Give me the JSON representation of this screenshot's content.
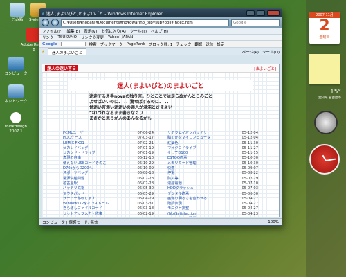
{
  "desktop": {
    "icons": [
      {
        "label": "ごみ箱"
      },
      {
        "label": "S-ViewNX"
      },
      {
        "label": "Adobe Reader 8"
      },
      {
        "label": "コンピュータ"
      },
      {
        "label": "ネットワーク"
      },
      {
        "label": "thinkdesign 2007.1"
      }
    ]
  },
  "window": {
    "title": "迷人(まよいびと)のまよいごと - Windows Internet Explorer",
    "address": "C:¥Users¥nobata¥Documents¥hp¥owarino_top¥sub¥ooli¥index.htm",
    "search_placeholder": "Google",
    "menu": [
      "ファイル(F)",
      "編集(E)",
      "表示(V)",
      "お気に入り(A)",
      "ツール(T)",
      "ヘルプ(H)"
    ],
    "links": [
      "リンク",
      "TSUKUMO",
      "リンクの変更",
      "Yahoo! JAPAN"
    ],
    "google_bar": [
      "Google",
      "検索",
      "ブックマーク",
      "PageRank",
      "ブロック数: 1",
      "チェック",
      "翻訳",
      "送信",
      "設定"
    ],
    "tab_label": "迷人のまよいごと",
    "tab_tools": [
      "ページ(P)",
      "ツール(O)"
    ],
    "status_left": "コンピュータ | 保護モード: 無効",
    "zoom": "100%"
  },
  "page": {
    "header_left": "迷人の迷い言ら",
    "header_right": "[まよいごと]",
    "title": "迷人(まよいびと)のまよいごと",
    "intro_lines": [
      "迷走する矛手novaの独り言。ひとことでは足らぬかんとこみごと",
      "よせばいいのに． ．．驚せばするのに． ．．",
      "世迷い言迷い迷迷いの迷人が混沌とさまよい",
      "つれづれなるまま書きなぐり",
      "まさかと思うが人のあんなるかも"
    ],
    "left_list": [
      {
        "name": "PCMLユーザー",
        "date": "07-06-24"
      },
      {
        "name": "HDDケース",
        "date": "07-03-17"
      },
      {
        "name": "LUMIX FX01",
        "date": "07-02-21"
      },
      {
        "name": "セカンドバッグ",
        "date": "07-01-19"
      },
      {
        "name": "セカンド・ドライブ",
        "date": "07-01-19"
      },
      {
        "name": "表現の自由",
        "date": "06-12-10"
      },
      {
        "name": "使えないUSBカードきのこ",
        "date": "06-10-29"
      },
      {
        "name": "D70sからD200へ",
        "date": "06-10-09"
      },
      {
        "name": "スポーツバッグ",
        "date": "06-08-18"
      },
      {
        "name": "電源供給問題",
        "date": "06-07-28"
      },
      {
        "name": "名古屋駅",
        "date": "06-07-28"
      },
      {
        "name": "バッテリ充電",
        "date": "06-05-30"
      },
      {
        "name": "マウスパッド",
        "date": "06-05-29"
      },
      {
        "name": "サーバー移転します",
        "date": "06-04-29"
      },
      {
        "name": "WindowsXPをインストール",
        "date": "06-03-31"
      },
      {
        "name": "きらぼしファイルカード",
        "date": "06-03-18"
      },
      {
        "name": "セットアップ入力・修復",
        "date": "06-02-19"
      },
      {
        "name": "iPod shuffle",
        "date": "05-12-29"
      }
    ],
    "right_list": [
      {
        "name": "リチウムイオンバッテリー",
        "date": "05-12-04"
      },
      {
        "name": "脳でかなマイコンピュータ",
        "date": "05-12-04"
      },
      {
        "name": "紅葉色",
        "date": "05-11-30"
      },
      {
        "name": "マイクロドライブ",
        "date": "05-11-27"
      },
      {
        "name": "そしてD100",
        "date": "05-11-15"
      },
      {
        "name": "ESTOO終焉",
        "date": "05-10-30"
      },
      {
        "name": "メモリカード管理",
        "date": "05-10-30"
      },
      {
        "name": "快適",
        "date": "05-09-07"
      },
      {
        "name": "停電",
        "date": "05-08-22"
      },
      {
        "name": "防災等",
        "date": "05-07-29"
      },
      {
        "name": "液晶電池",
        "date": "05-07-10"
      },
      {
        "name": "HDDクラッシュ",
        "date": "05-07-03"
      },
      {
        "name": "デジタル終焉",
        "date": "05-06-30"
      },
      {
        "name": "画像の明るさを合わせる",
        "date": "05-04-27"
      },
      {
        "name": "階調表現",
        "date": "05-04-27"
      },
      {
        "name": "モニター調整",
        "date": "05-04-27"
      },
      {
        "name": "(No)Satisfaction",
        "date": "05-04-23"
      },
      {
        "name": "メモリカード配置",
        "date": "05-04-23"
      }
    ]
  },
  "gadgets": {
    "calendar_month": "2007 11月",
    "calendar_day": "2",
    "calendar_weekday": "金曜日",
    "weather_temp": "15°",
    "weather_loc": "愛知県 名古屋市"
  }
}
